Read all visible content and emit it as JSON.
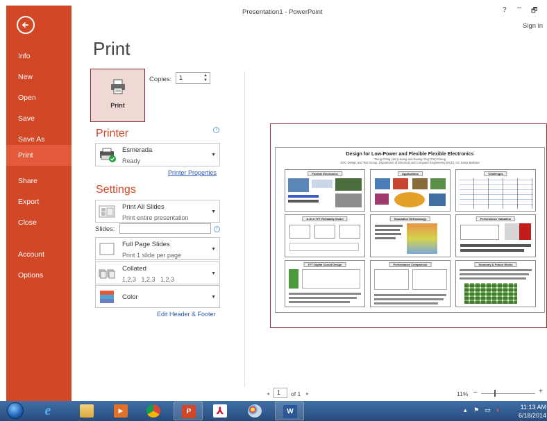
{
  "window": {
    "title": "Presentation1 - PowerPoint",
    "help": "?",
    "minimize": "–",
    "restore": "🗗",
    "sign_in": "Sign in"
  },
  "sidebar": {
    "items": [
      {
        "label": "Info"
      },
      {
        "label": "New"
      },
      {
        "label": "Open"
      },
      {
        "label": "Save"
      },
      {
        "label": "Save As"
      },
      {
        "label": "Print",
        "active": true
      },
      {
        "label": "Share"
      },
      {
        "label": "Export"
      },
      {
        "label": "Close"
      },
      {
        "label": "Account"
      },
      {
        "label": "Options"
      }
    ],
    "color": "#d24726"
  },
  "print": {
    "page_title": "Print",
    "button_label": "Print",
    "copies_label": "Copies:",
    "copies_value": "1"
  },
  "printer": {
    "heading": "Printer",
    "name": "Esmerada",
    "status": "Ready",
    "properties_link": "Printer Properties"
  },
  "settings": {
    "heading": "Settings",
    "slides_range": {
      "main": "Print All Slides",
      "sub": "Print entire presentation"
    },
    "slides_label": "Slides:",
    "slides_value": "",
    "layout": {
      "main": "Full Page Slides",
      "sub": "Print 1 slide per page"
    },
    "collation": {
      "main": "Collated",
      "sub": "1,2,3   1,2,3   1,2,3"
    },
    "color": {
      "main": "Color"
    },
    "edit_header_footer": "Edit Header & Footer"
  },
  "preview": {
    "poster_title": "Design for Low-Power and Flexible Flexible Electronics",
    "poster_authors": "Tsung-Ching (Jim) Huang and Kwang-Ting (Tim) Cheng",
    "poster_group": "SOC Design and Test Group, Department of Electrical and Computer Engineering (ECE), UC Santa Barbara",
    "panels": [
      "Flexible Electronics",
      "Applications",
      "Challenges",
      "A-Si:H TFT Reliability Model",
      "Simulation Methodology",
      "Performance Validation",
      "TFT Digital Circuit Design",
      "Performance Comparison",
      "Summary & Future Works"
    ]
  },
  "pagination": {
    "prev": "◂",
    "page": "1",
    "of": "of 1",
    "next": "▸",
    "zoom": "11%",
    "zoom_minus": "–",
    "zoom_plus": "+",
    "zoom_fraction": 0.11
  },
  "taskbar": {
    "apps": [
      {
        "name": "internet-explorer",
        "glyph": "e"
      },
      {
        "name": "file-explorer",
        "glyph": ""
      },
      {
        "name": "media-player",
        "glyph": "▶"
      },
      {
        "name": "chrome",
        "glyph": ""
      },
      {
        "name": "powerpoint",
        "glyph": "P"
      },
      {
        "name": "acrobat",
        "glyph": "⅄"
      },
      {
        "name": "paint",
        "glyph": ""
      },
      {
        "name": "word",
        "glyph": "W"
      }
    ],
    "clock_time": "11:13 AM",
    "clock_date": "6/18/2014"
  }
}
